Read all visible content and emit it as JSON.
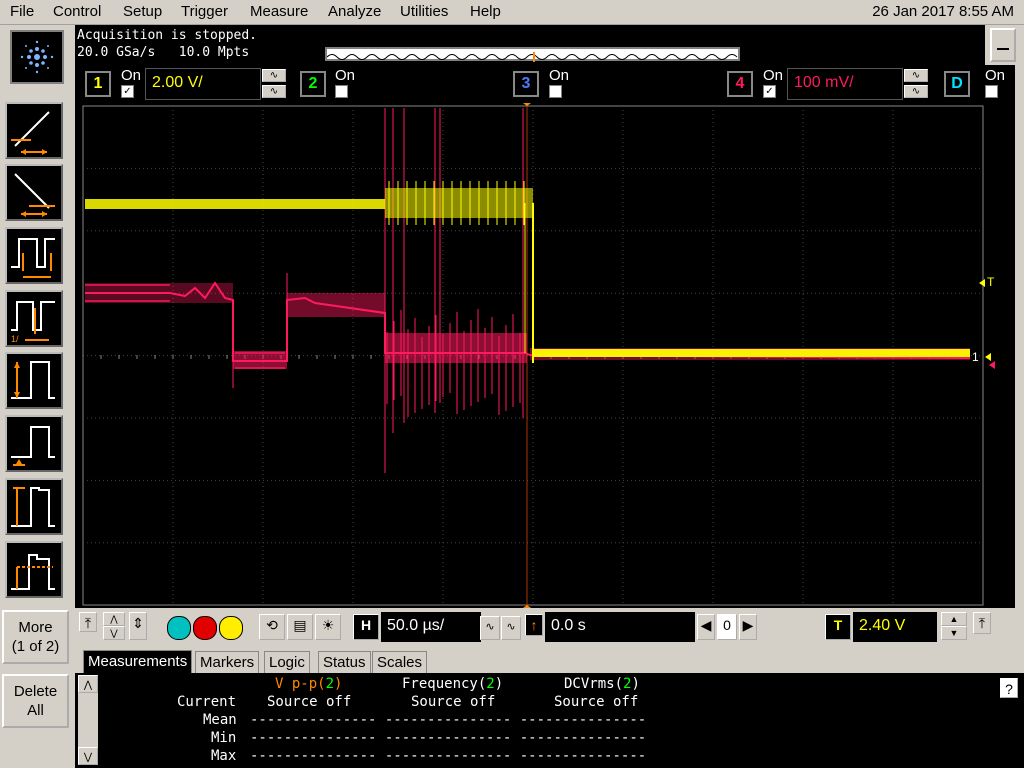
{
  "menu": [
    "File",
    "Control",
    "Setup",
    "Trigger",
    "Measure",
    "Analyze",
    "Utilities",
    "Help"
  ],
  "datetime": "26 Jan 2017   8:55 AM",
  "status": {
    "acquisition": "Acquisition is stopped.",
    "rate": "20.0 GSa/s   10.0 Mpts"
  },
  "left_panel": {
    "more_label_1": "More",
    "more_label_2": "(1 of 2)",
    "delete_label_1": "Delete",
    "delete_label_2": "All"
  },
  "channels": {
    "ch1": {
      "num": "1",
      "on": "On",
      "scale": "2.00 V/",
      "color": "#ffff00"
    },
    "ch2": {
      "num": "2",
      "on": "On",
      "color": "#00ff00"
    },
    "ch3": {
      "num": "3",
      "on": "On",
      "color": "#4a7bff"
    },
    "ch4": {
      "num": "4",
      "on": "On",
      "scale": "100 mV/",
      "color": "#ff1a5e"
    },
    "chD": {
      "num": "D",
      "on": "On",
      "color": "#00e5ff"
    }
  },
  "scope_markers": {
    "trig_label": "T",
    "ch1_marker": "1"
  },
  "timebase": {
    "h_label": "H",
    "scale": "50.0 µs/",
    "delay": "0.0 s",
    "zoom_val": "0"
  },
  "trigger": {
    "t_label": "T",
    "level": "2.40 V"
  },
  "tabs": [
    "Measurements",
    "Markers",
    "Logic",
    "Status",
    "Scales"
  ],
  "measurements": {
    "headers": [
      {
        "name": "V p-p(",
        "src": "2",
        "close": ")"
      },
      {
        "name": "Frequency(",
        "src": "2",
        "close": ")"
      },
      {
        "name": "DCVrms(",
        "src": "2",
        "close": ")"
      }
    ],
    "row_labels": [
      "Current",
      "Mean",
      "Min",
      "Max"
    ],
    "current_values": [
      "Source off",
      "Source off",
      "Source off"
    ],
    "dash": "---------------"
  },
  "help_label": "?"
}
